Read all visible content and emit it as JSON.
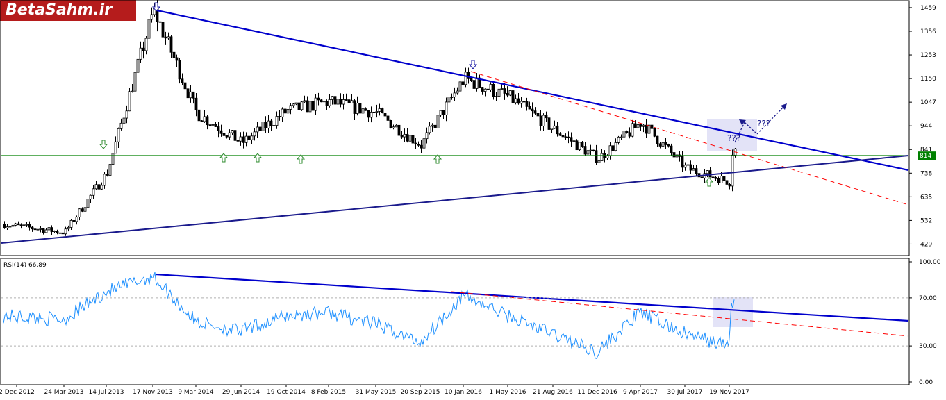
{
  "brand": {
    "logo_text": "BetaSahm.ir"
  },
  "colors": {
    "candle": "#000000",
    "trendline_blue": "#0000cc",
    "support_line": "#008000",
    "dashed_line": "#ff0000",
    "rsi_line": "#1e90ff",
    "highlight": "#dcdcf5",
    "arrow_green": "#2e8b2e",
    "arrow_blue": "#1a1aa6"
  },
  "chart_data": [
    {
      "type": "candlestick",
      "title": "",
      "price_axis_ticks": [
        1459,
        1356,
        1253,
        1150,
        1047,
        944,
        841,
        738,
        635,
        532,
        429
      ],
      "current_level_label": "814",
      "ylim": [
        385,
        1480
      ],
      "x_tick_labels": [
        "2 Dec 2012",
        "24 Mar 2013",
        "14 Jul 2013",
        "17 Nov 2013",
        "9 Mar 2014",
        "29 Jun 2014",
        "19 Oct 2014",
        "8 Feb 2015",
        "31 May 2015",
        "20 Sep 2015",
        "10 Jan 2016",
        "1 May 2016",
        "21 Aug 2016",
        "11 Dec 2016",
        "9 Apr 2017",
        "30 Jul 2017",
        "19 Nov 2017"
      ],
      "approx_close_path": [
        {
          "date": "2 Dec 2012",
          "value": 515
        },
        {
          "date": "24 Mar 2013",
          "value": 480
        },
        {
          "date": "14 Jul 2013",
          "value": 740
        },
        {
          "date": "17 Nov 2013",
          "value": 1450
        },
        {
          "date": "9 Mar 2014",
          "value": 1000
        },
        {
          "date": "29 Jun 2014",
          "value": 870
        },
        {
          "date": "19 Oct 2014",
          "value": 1010
        },
        {
          "date": "8 Feb 2015",
          "value": 1050
        },
        {
          "date": "31 May 2015",
          "value": 1000
        },
        {
          "date": "20 Sep 2015",
          "value": 860
        },
        {
          "date": "10 Jan 2016",
          "value": 1150
        },
        {
          "date": "1 May 2016",
          "value": 1070
        },
        {
          "date": "21 Aug 2016",
          "value": 930
        },
        {
          "date": "11 Dec 2016",
          "value": 800
        },
        {
          "date": "9 Apr 2017",
          "value": 960
        },
        {
          "date": "30 Jul 2017",
          "value": 760
        },
        {
          "date": "19 Nov 2017",
          "value": 700
        },
        {
          "date": "19 Nov 2017",
          "value": 841
        }
      ],
      "annotations": [
        "???",
        "???"
      ],
      "support_level": 814
    },
    {
      "type": "line",
      "title": "RSI(14) 66.89",
      "indicator": "RSI(14)",
      "last_value": 66.89,
      "axis_ticks": [
        "100.00",
        "70.00",
        "30.00",
        "0.00"
      ],
      "ylim": [
        0,
        100
      ],
      "reference_levels": [
        70,
        30
      ],
      "approx_values": [
        {
          "date": "2 Dec 2012",
          "value": 55
        },
        {
          "date": "24 Mar 2013",
          "value": 52
        },
        {
          "date": "14 Jul 2013",
          "value": 75
        },
        {
          "date": "17 Nov 2013",
          "value": 88
        },
        {
          "date": "9 Mar 2014",
          "value": 50
        },
        {
          "date": "29 Jun 2014",
          "value": 42
        },
        {
          "date": "19 Oct 2014",
          "value": 55
        },
        {
          "date": "8 Feb 2015",
          "value": 58
        },
        {
          "date": "31 May 2015",
          "value": 48
        },
        {
          "date": "20 Sep 2015",
          "value": 33
        },
        {
          "date": "10 Jan 2016",
          "value": 72
        },
        {
          "date": "1 May 2016",
          "value": 55
        },
        {
          "date": "21 Aug 2016",
          "value": 40
        },
        {
          "date": "11 Dec 2016",
          "value": 25
        },
        {
          "date": "9 Apr 2017",
          "value": 58
        },
        {
          "date": "30 Jul 2017",
          "value": 40
        },
        {
          "date": "19 Nov 2017",
          "value": 30
        },
        {
          "date": "19 Nov 2017",
          "value": 66.89
        }
      ]
    }
  ]
}
